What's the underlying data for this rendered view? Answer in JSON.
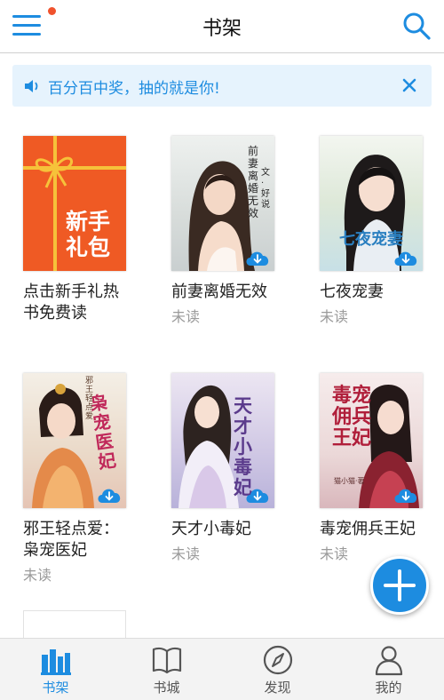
{
  "header": {
    "title": "书架",
    "has_notification_dot": true
  },
  "notice": {
    "text": "百分百中奖，抽的就是你!"
  },
  "books": [
    {
      "title": "点击新手礼热书免费读",
      "cover_text": "新手礼包",
      "status": ""
    },
    {
      "title": "前妻离婚无效",
      "cover_text": "前妻离婚无效",
      "cover_sub": "文·好说",
      "status": "未读"
    },
    {
      "title": "七夜宠妻",
      "cover_text": "七夜宠妻",
      "status": "未读"
    },
    {
      "title": "邪王轻点爱：枭宠医妃",
      "cover_text": "枭宠医妃",
      "cover_sub": "邪王轻点爱",
      "status": "未读"
    },
    {
      "title": "天才小毒妃",
      "cover_text": "天才小毒妃",
      "status": "未读"
    },
    {
      "title": "毒宠佣兵王妃",
      "cover_text": "毒宠佣兵王妃",
      "cover_sub": "猫小猫·著",
      "status": "未读"
    }
  ],
  "tabs": [
    {
      "label": "书架",
      "icon": "bookshelf-icon",
      "active": true
    },
    {
      "label": "书城",
      "icon": "book-icon",
      "active": false
    },
    {
      "label": "发现",
      "icon": "compass-icon",
      "active": false
    },
    {
      "label": "我的",
      "icon": "person-icon",
      "active": false
    }
  ],
  "colors": {
    "accent": "#1d8ce0",
    "notice_bg": "#e6f3fd",
    "gift_cover": "#ef5a24",
    "ribbon": "#f6c23a",
    "dot": "#f0522d"
  }
}
